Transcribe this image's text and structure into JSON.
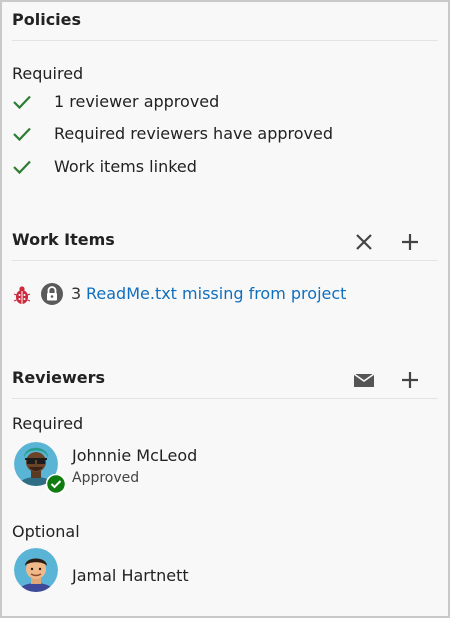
{
  "policies": {
    "title": "Policies",
    "required_label": "Required",
    "items": [
      {
        "label": "1 reviewer approved"
      },
      {
        "label": "Required reviewers have approved"
      },
      {
        "label": "Work items linked"
      }
    ]
  },
  "work_items": {
    "title": "Work Items",
    "item": {
      "number": "3",
      "title": "ReadMe.txt missing from project"
    }
  },
  "reviewers": {
    "title": "Reviewers",
    "required_label": "Required",
    "optional_label": "Optional",
    "required": [
      {
        "name": "Johnnie McLeod",
        "status": "Approved"
      }
    ],
    "optional": [
      {
        "name": "Jamal Hartnett"
      }
    ]
  },
  "colors": {
    "check": "#2e7d32",
    "link": "#106ebe",
    "bug": "#cc293d",
    "approved_badge": "#107c10"
  },
  "icons": {
    "check": "checkmark-icon",
    "remove": "close-icon",
    "add": "plus-icon",
    "mail": "mail-icon",
    "bug": "bug-icon",
    "user_story": "lock-icon"
  }
}
